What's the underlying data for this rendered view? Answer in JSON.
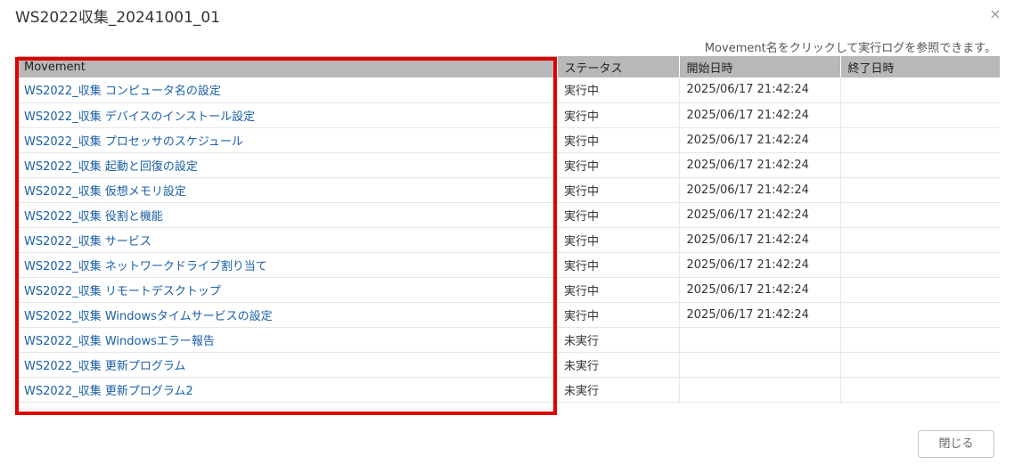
{
  "dialog": {
    "title": "WS2022収集_20241001_01",
    "close_icon": "×",
    "hint": "Movement名をクリックして実行ログを参照できます。",
    "close_button_label": "閉じる"
  },
  "table": {
    "headers": [
      "Movement",
      "ステータス",
      "開始日時",
      "終了日時"
    ],
    "rows": [
      {
        "movement": "WS2022_収集 コンピュータ名の設定",
        "status": "実行中",
        "start": "2025/06/17 21:42:24",
        "end": ""
      },
      {
        "movement": "WS2022_収集 デバイスのインストール設定",
        "status": "実行中",
        "start": "2025/06/17 21:42:24",
        "end": ""
      },
      {
        "movement": "WS2022_収集 プロセッサのスケジュール",
        "status": "実行中",
        "start": "2025/06/17 21:42:24",
        "end": ""
      },
      {
        "movement": "WS2022_収集 起動と回復の設定",
        "status": "実行中",
        "start": "2025/06/17 21:42:24",
        "end": ""
      },
      {
        "movement": "WS2022_収集 仮想メモリ設定",
        "status": "実行中",
        "start": "2025/06/17 21:42:24",
        "end": ""
      },
      {
        "movement": "WS2022_収集 役割と機能",
        "status": "実行中",
        "start": "2025/06/17 21:42:24",
        "end": ""
      },
      {
        "movement": "WS2022_収集 サービス",
        "status": "実行中",
        "start": "2025/06/17 21:42:24",
        "end": ""
      },
      {
        "movement": "WS2022_収集 ネットワークドライブ割り当て",
        "status": "実行中",
        "start": "2025/06/17 21:42:24",
        "end": ""
      },
      {
        "movement": "WS2022_収集 リモートデスクトップ",
        "status": "実行中",
        "start": "2025/06/17 21:42:24",
        "end": ""
      },
      {
        "movement": "WS2022_収集 Windowsタイムサービスの設定",
        "status": "実行中",
        "start": "2025/06/17 21:42:24",
        "end": ""
      },
      {
        "movement": "WS2022_収集 Windowsエラー報告",
        "status": "未実行",
        "start": "",
        "end": ""
      },
      {
        "movement": "WS2022_収集 更新プログラム",
        "status": "未実行",
        "start": "",
        "end": ""
      },
      {
        "movement": "WS2022_収集 更新プログラム2",
        "status": "未実行",
        "start": "",
        "end": ""
      }
    ]
  },
  "colors": {
    "highlight_border": "#e00000",
    "link": "#1a5fa8",
    "header_bg": "#b8b8b8"
  }
}
